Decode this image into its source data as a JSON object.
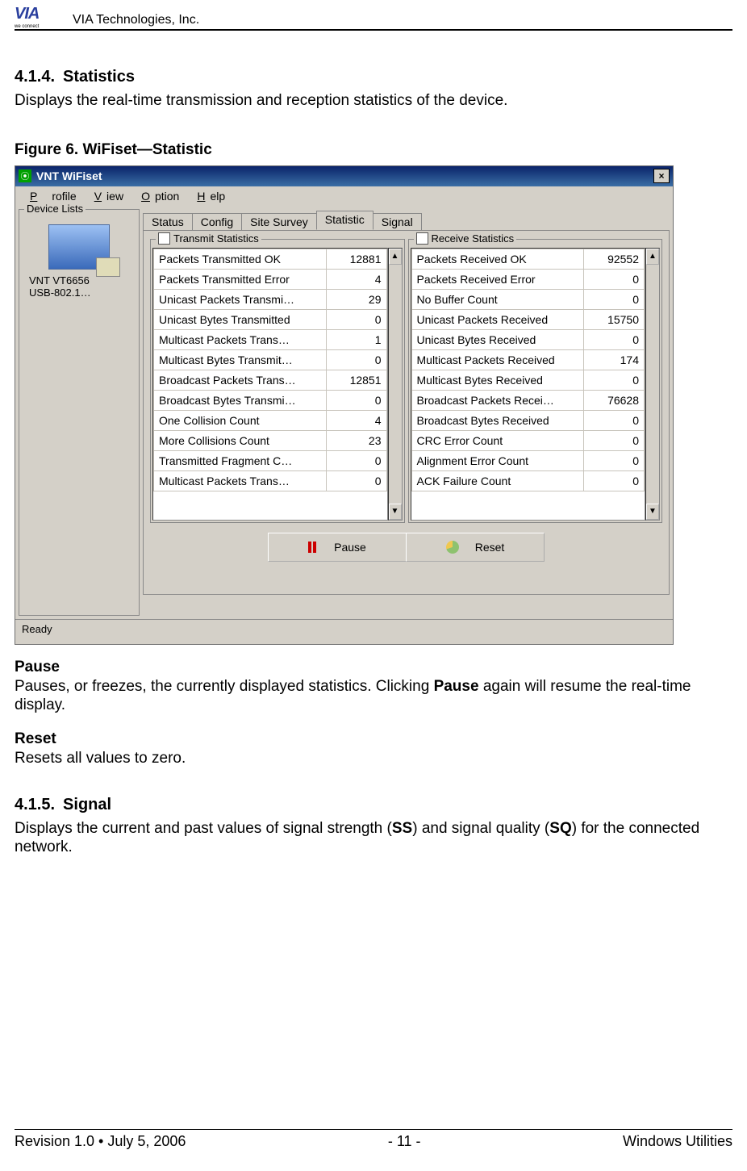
{
  "header": {
    "logo_text": "VIA",
    "logo_sub": "we connect",
    "company": "VIA Technologies, Inc."
  },
  "section414": {
    "number": "4.1.4.",
    "title": "Statistics",
    "desc": "Displays the real-time transmission and reception statistics of the device."
  },
  "figure": {
    "caption": "Figure 6. WiFiset—Statistic"
  },
  "window": {
    "title": "VNT WiFiset",
    "menu": {
      "profile": "Profile",
      "view": "View",
      "option": "Option",
      "help": "Help"
    },
    "device_lists_label": "Device Lists",
    "device_name_line1": "VNT VT6656",
    "device_name_line2": "USB-802.1…",
    "tabs": {
      "status": "Status",
      "config": "Config",
      "site": "Site Survey",
      "statistic": "Statistic",
      "signal": "Signal"
    },
    "tx_legend": "Transmit Statistics",
    "rx_legend": "Receive Statistics",
    "tx": [
      {
        "k": "Packets Transmitted OK",
        "v": "12881"
      },
      {
        "k": "Packets Transmitted Error",
        "v": "4"
      },
      {
        "k": "Unicast Packets Transmi…",
        "v": "29"
      },
      {
        "k": "Unicast Bytes Transmitted",
        "v": "0"
      },
      {
        "k": "Multicast Packets Trans…",
        "v": "1"
      },
      {
        "k": "Multicast Bytes Transmit…",
        "v": "0"
      },
      {
        "k": "Broadcast Packets Trans…",
        "v": "12851"
      },
      {
        "k": "Broadcast Bytes Transmi…",
        "v": "0"
      },
      {
        "k": "One Collision Count",
        "v": "4"
      },
      {
        "k": "More Collisions Count",
        "v": "23"
      },
      {
        "k": "Transmitted Fragment C…",
        "v": "0"
      },
      {
        "k": "Multicast Packets Trans…",
        "v": "0"
      }
    ],
    "rx": [
      {
        "k": "Packets Received OK",
        "v": "92552"
      },
      {
        "k": "Packets Received Error",
        "v": "0"
      },
      {
        "k": "No Buffer Count",
        "v": "0"
      },
      {
        "k": "Unicast Packets Received",
        "v": "15750"
      },
      {
        "k": "Unicast Bytes Received",
        "v": "0"
      },
      {
        "k": "Multicast Packets Received",
        "v": "174"
      },
      {
        "k": "Multicast Bytes Received",
        "v": "0"
      },
      {
        "k": "Broadcast Packets Recei…",
        "v": "76628"
      },
      {
        "k": "Broadcast Bytes Received",
        "v": "0"
      },
      {
        "k": "CRC Error Count",
        "v": "0"
      },
      {
        "k": "Alignment Error Count",
        "v": "0"
      },
      {
        "k": "ACK Failure Count",
        "v": "0"
      }
    ],
    "buttons": {
      "pause": "Pause",
      "reset": "Reset"
    },
    "status": "Ready"
  },
  "below": {
    "pause_hdr": "Pause",
    "pause_txt_1": "Pauses, or freezes, the currently displayed statistics. Clicking ",
    "pause_bold": "Pause",
    "pause_txt_2": " again will resume the real-time display.",
    "reset_hdr": "Reset",
    "reset_txt": "Resets all values to zero."
  },
  "section415": {
    "number": "4.1.5.",
    "title": "Signal",
    "pre": "Displays the current and past values of signal strength (",
    "ss": "SS",
    "mid": ") and signal quality (",
    "sq": "SQ",
    "post": ") for the connected network."
  },
  "footer": {
    "left": "Revision 1.0 • July 5, 2006",
    "center": "- 11 -",
    "right": "Windows Utilities"
  }
}
